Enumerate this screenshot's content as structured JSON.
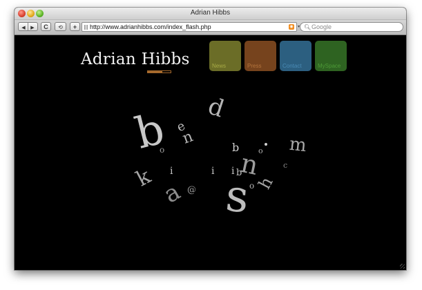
{
  "window": {
    "title": "Adrian Hibbs"
  },
  "toolbar": {
    "back_label": "◀",
    "forward_label": "▶",
    "reload_label": "C",
    "snapback_label": "⟲",
    "add_bookmark_label": "+",
    "url": "http://www.adrianhibbs.com/index_flash.php",
    "search_placeholder": "Google"
  },
  "site": {
    "logo": "Adrian Hibbs",
    "loader_progress": 0.65,
    "nav": [
      {
        "label": "News",
        "color": "#6b6d27"
      },
      {
        "label": "Press",
        "color": "#76431d"
      },
      {
        "label": "Contact",
        "color": "#2c5f80"
      },
      {
        "label": "MySpace",
        "color": "#2e6321"
      }
    ]
  },
  "letters": [
    "b",
    "d",
    "n",
    "b",
    "o",
    "m",
    "n",
    "c",
    "k",
    "i",
    "i",
    "i",
    "b",
    "a",
    "@",
    "s",
    "h",
    "e",
    "o",
    "o"
  ]
}
